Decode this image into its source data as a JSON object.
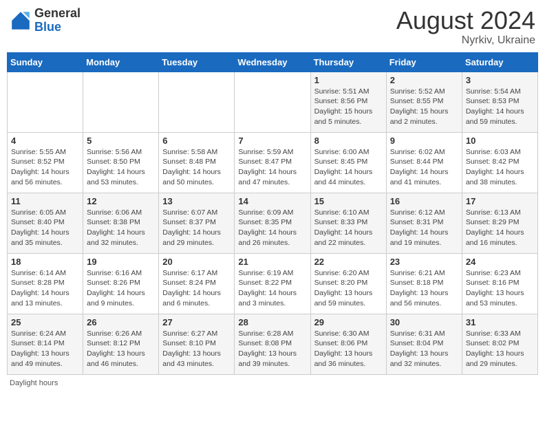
{
  "header": {
    "logo_general": "General",
    "logo_blue": "Blue",
    "month_year": "August 2024",
    "location": "Nyrkiv, Ukraine"
  },
  "footer": {
    "daylight_label": "Daylight hours"
  },
  "days_of_week": [
    "Sunday",
    "Monday",
    "Tuesday",
    "Wednesday",
    "Thursday",
    "Friday",
    "Saturday"
  ],
  "weeks": [
    [
      {
        "day": "",
        "info": ""
      },
      {
        "day": "",
        "info": ""
      },
      {
        "day": "",
        "info": ""
      },
      {
        "day": "",
        "info": ""
      },
      {
        "day": "1",
        "info": "Sunrise: 5:51 AM\nSunset: 8:56 PM\nDaylight: 15 hours\nand 5 minutes."
      },
      {
        "day": "2",
        "info": "Sunrise: 5:52 AM\nSunset: 8:55 PM\nDaylight: 15 hours\nand 2 minutes."
      },
      {
        "day": "3",
        "info": "Sunrise: 5:54 AM\nSunset: 8:53 PM\nDaylight: 14 hours\nand 59 minutes."
      }
    ],
    [
      {
        "day": "4",
        "info": "Sunrise: 5:55 AM\nSunset: 8:52 PM\nDaylight: 14 hours\nand 56 minutes."
      },
      {
        "day": "5",
        "info": "Sunrise: 5:56 AM\nSunset: 8:50 PM\nDaylight: 14 hours\nand 53 minutes."
      },
      {
        "day": "6",
        "info": "Sunrise: 5:58 AM\nSunset: 8:48 PM\nDaylight: 14 hours\nand 50 minutes."
      },
      {
        "day": "7",
        "info": "Sunrise: 5:59 AM\nSunset: 8:47 PM\nDaylight: 14 hours\nand 47 minutes."
      },
      {
        "day": "8",
        "info": "Sunrise: 6:00 AM\nSunset: 8:45 PM\nDaylight: 14 hours\nand 44 minutes."
      },
      {
        "day": "9",
        "info": "Sunrise: 6:02 AM\nSunset: 8:44 PM\nDaylight: 14 hours\nand 41 minutes."
      },
      {
        "day": "10",
        "info": "Sunrise: 6:03 AM\nSunset: 8:42 PM\nDaylight: 14 hours\nand 38 minutes."
      }
    ],
    [
      {
        "day": "11",
        "info": "Sunrise: 6:05 AM\nSunset: 8:40 PM\nDaylight: 14 hours\nand 35 minutes."
      },
      {
        "day": "12",
        "info": "Sunrise: 6:06 AM\nSunset: 8:38 PM\nDaylight: 14 hours\nand 32 minutes."
      },
      {
        "day": "13",
        "info": "Sunrise: 6:07 AM\nSunset: 8:37 PM\nDaylight: 14 hours\nand 29 minutes."
      },
      {
        "day": "14",
        "info": "Sunrise: 6:09 AM\nSunset: 8:35 PM\nDaylight: 14 hours\nand 26 minutes."
      },
      {
        "day": "15",
        "info": "Sunrise: 6:10 AM\nSunset: 8:33 PM\nDaylight: 14 hours\nand 22 minutes."
      },
      {
        "day": "16",
        "info": "Sunrise: 6:12 AM\nSunset: 8:31 PM\nDaylight: 14 hours\nand 19 minutes."
      },
      {
        "day": "17",
        "info": "Sunrise: 6:13 AM\nSunset: 8:29 PM\nDaylight: 14 hours\nand 16 minutes."
      }
    ],
    [
      {
        "day": "18",
        "info": "Sunrise: 6:14 AM\nSunset: 8:28 PM\nDaylight: 14 hours\nand 13 minutes."
      },
      {
        "day": "19",
        "info": "Sunrise: 6:16 AM\nSunset: 8:26 PM\nDaylight: 14 hours\nand 9 minutes."
      },
      {
        "day": "20",
        "info": "Sunrise: 6:17 AM\nSunset: 8:24 PM\nDaylight: 14 hours\nand 6 minutes."
      },
      {
        "day": "21",
        "info": "Sunrise: 6:19 AM\nSunset: 8:22 PM\nDaylight: 14 hours\nand 3 minutes."
      },
      {
        "day": "22",
        "info": "Sunrise: 6:20 AM\nSunset: 8:20 PM\nDaylight: 13 hours\nand 59 minutes."
      },
      {
        "day": "23",
        "info": "Sunrise: 6:21 AM\nSunset: 8:18 PM\nDaylight: 13 hours\nand 56 minutes."
      },
      {
        "day": "24",
        "info": "Sunrise: 6:23 AM\nSunset: 8:16 PM\nDaylight: 13 hours\nand 53 minutes."
      }
    ],
    [
      {
        "day": "25",
        "info": "Sunrise: 6:24 AM\nSunset: 8:14 PM\nDaylight: 13 hours\nand 49 minutes."
      },
      {
        "day": "26",
        "info": "Sunrise: 6:26 AM\nSunset: 8:12 PM\nDaylight: 13 hours\nand 46 minutes."
      },
      {
        "day": "27",
        "info": "Sunrise: 6:27 AM\nSunset: 8:10 PM\nDaylight: 13 hours\nand 43 minutes."
      },
      {
        "day": "28",
        "info": "Sunrise: 6:28 AM\nSunset: 8:08 PM\nDaylight: 13 hours\nand 39 minutes."
      },
      {
        "day": "29",
        "info": "Sunrise: 6:30 AM\nSunset: 8:06 PM\nDaylight: 13 hours\nand 36 minutes."
      },
      {
        "day": "30",
        "info": "Sunrise: 6:31 AM\nSunset: 8:04 PM\nDaylight: 13 hours\nand 32 minutes."
      },
      {
        "day": "31",
        "info": "Sunrise: 6:33 AM\nSunset: 8:02 PM\nDaylight: 13 hours\nand 29 minutes."
      }
    ]
  ]
}
